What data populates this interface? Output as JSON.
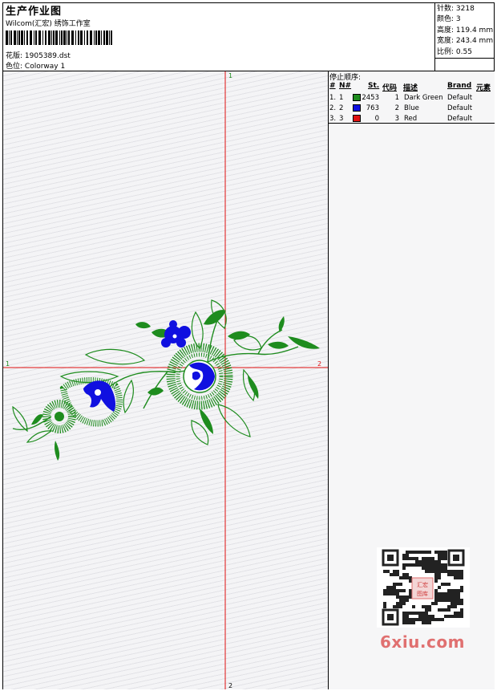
{
  "header": {
    "title": "生产作业图",
    "subtitle": "Wilcom(汇宏) 绣饰工作室",
    "design_label": "花版:",
    "design_value": "1905389.dst",
    "colorway_label": "色位:",
    "colorway_value": "Colorway 1"
  },
  "stats": {
    "stitches_label": "针数:",
    "stitches_value": "3218",
    "colors_label": "颜色:",
    "colors_value": "3",
    "height_label": "高度:",
    "height_value": "119.4 mm",
    "width_label": "宽度:",
    "width_value": "243.4 mm",
    "scale_label": "比例:",
    "scale_value": "0.55"
  },
  "sequence": {
    "title": "停止顺序:",
    "columns": [
      "#",
      "N#",
      "St.",
      "代码",
      "描述",
      "Brand",
      "元素"
    ],
    "rows": [
      {
        "idx": "1.",
        "n": "1",
        "color": "#1e8c1e",
        "st": "2453",
        "code": "1",
        "desc": "Dark Green",
        "brand": "Default"
      },
      {
        "idx": "2.",
        "n": "2",
        "color": "#1010e0",
        "st": "763",
        "code": "2",
        "desc": "Blue",
        "brand": "Default"
      },
      {
        "idx": "3.",
        "n": "3",
        "color": "#e01010",
        "st": "0",
        "code": "3",
        "desc": "Red",
        "brand": "Default"
      }
    ]
  },
  "canvas": {
    "h_start": "1",
    "h_end": "2",
    "v_start": "1",
    "v_end": "2"
  },
  "watermark": {
    "site": "6xiu.com",
    "stamp": "汇宏图库"
  },
  "colors": {
    "thread_green": "#1e8c1e",
    "thread_blue": "#1010e0",
    "crosshair": "#e01010",
    "watermark": "#e07070"
  },
  "icons": {
    "barcode": "barcode-icon",
    "qr": "qr-code-icon"
  }
}
